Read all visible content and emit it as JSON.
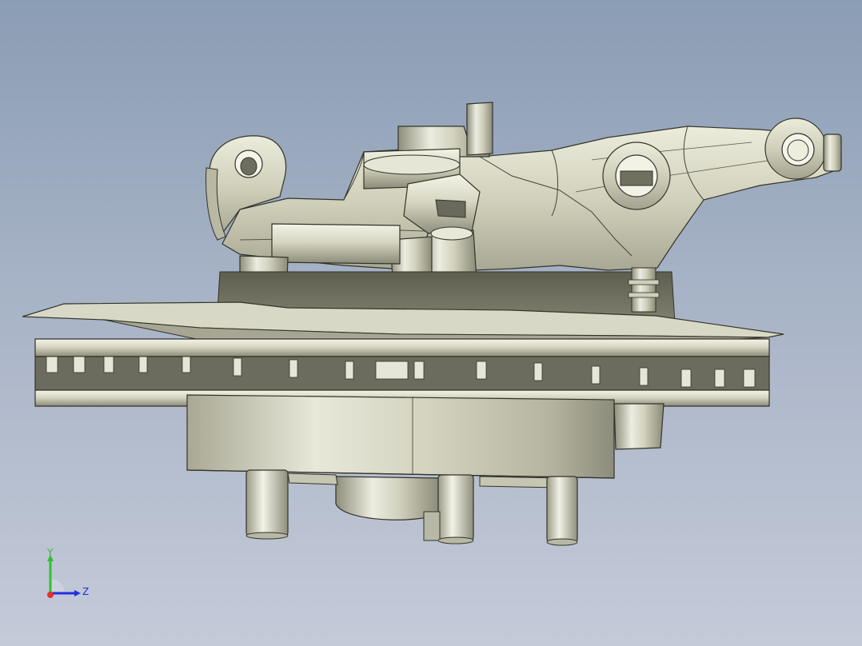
{
  "viewport": {
    "background_top": "#8b9db4",
    "background_bottom": "#c4cad8",
    "model_color": "#d8d8c4"
  },
  "triad": {
    "y_label": "Y",
    "z_label": "Z",
    "x_color": "#e03030",
    "y_color": "#30c030",
    "z_color": "#2030e0"
  }
}
